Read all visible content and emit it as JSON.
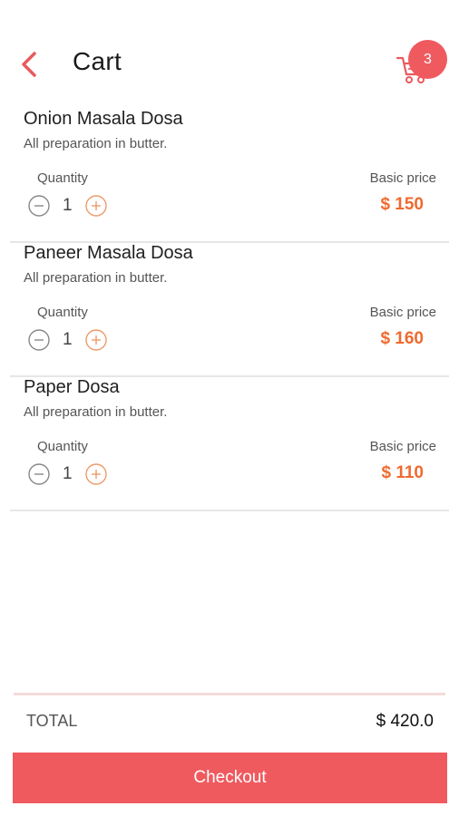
{
  "header": {
    "title": "Cart",
    "back_icon": "chevron-left-icon",
    "cart_icon": "shopping-cart-icon",
    "cart_count": "3",
    "accent_color": "#ef5a5f"
  },
  "items": [
    {
      "name": "Onion Masala Dosa",
      "description": "All preparation in butter.",
      "quantity_label": "Quantity",
      "quantity": "1",
      "price_label": "Basic price",
      "price": "$ 150"
    },
    {
      "name": "Paneer Masala Dosa",
      "description": "All preparation in butter.",
      "quantity_label": "Quantity",
      "quantity": "1",
      "price_label": "Basic price",
      "price": "$ 160"
    },
    {
      "name": "Paper Dosa",
      "description": "All preparation in butter.",
      "quantity_label": "Quantity",
      "quantity": "1",
      "price_label": "Basic price",
      "price": "$ 110"
    }
  ],
  "summary": {
    "total_label": "TOTAL",
    "total_value": "$ 420.0"
  },
  "checkout": {
    "label": "Checkout"
  },
  "colors": {
    "price": "#ef6a2e",
    "button": "#ef5a5f"
  }
}
